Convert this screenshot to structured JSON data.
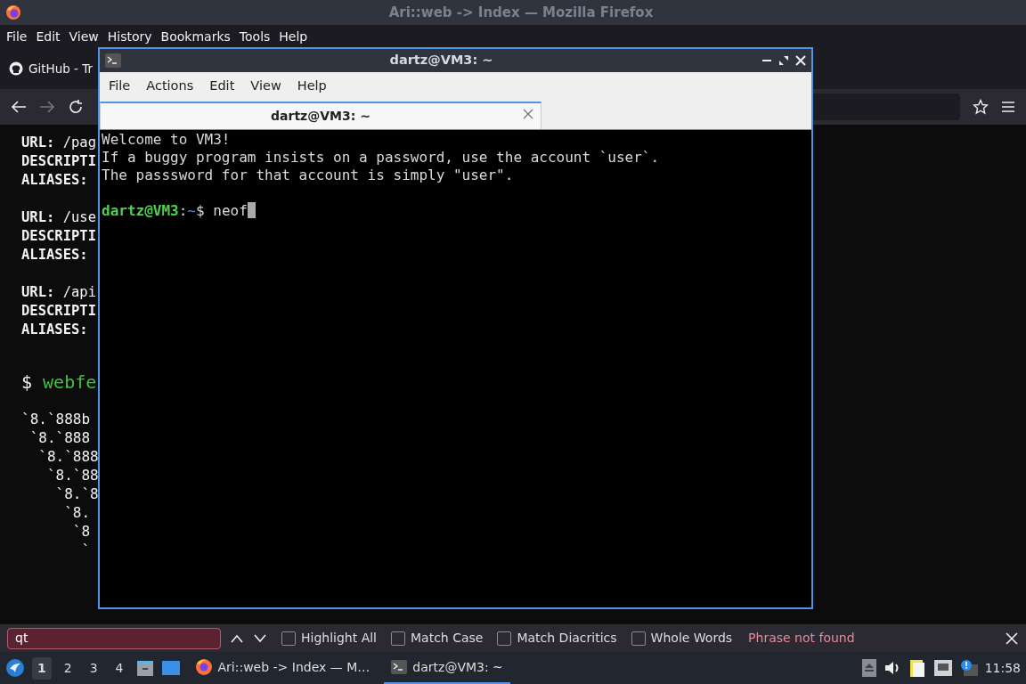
{
  "firefox": {
    "title": "Ari::web -> Index — Mozilla Firefox",
    "active": false,
    "menu": [
      "File",
      "Edit",
      "View",
      "History",
      "Bookmarks",
      "Tools",
      "Help"
    ],
    "tab": {
      "label": "GitHub - Tr"
    },
    "nav": {
      "forward": {
        "disabled": true
      }
    },
    "page": {
      "entries": [
        {
          "url": "**URL:** /pag",
          "description": "DESCRIPTI",
          "aliases": "ALIASES:"
        },
        {
          "url": "**URL:** /use",
          "description": "DESCRIPTI",
          "aliases": "ALIASES:"
        },
        {
          "url": "**URL:** /api",
          "description": "DESCRIPTI",
          "aliases": "ALIASES:"
        }
      ],
      "command": {
        "prompt": "$",
        "text": "webfe"
      },
      "art": [
        "`8.`888b",
        " `8.`888",
        "  `8.`888",
        "   `8.`88",
        "    `8.`8",
        "     `8.",
        "      `8",
        "       `"
      ]
    },
    "find_bar": {
      "value": "qt",
      "not_found": true,
      "options": [
        {
          "label": "Highlight All",
          "checked": false
        },
        {
          "label": "Match Case",
          "checked": false
        },
        {
          "label": "Match Diacritics",
          "checked": false
        },
        {
          "label": "Whole Words",
          "checked": false
        }
      ],
      "status": "Phrase not found"
    }
  },
  "terminal": {
    "title": "dartz@VM3: ~",
    "active": true,
    "menu": [
      "File",
      "Actions",
      "Edit",
      "View",
      "Help"
    ],
    "tabs": [
      {
        "label": "dartz@VM3: ~",
        "selected": true
      }
    ],
    "lines": [
      "Welcome to VM3!",
      "If a buggy program insists on a password, use the account `user`.",
      "The passsword for that account is simply \"user\"."
    ],
    "prompt": [
      {
        "text": "dartz@VM3",
        "kind": "user"
      },
      {
        "text": ":",
        "kind": "plain"
      },
      {
        "text": "~",
        "kind": "path"
      },
      {
        "text": "$ neof",
        "kind": "plain"
      }
    ]
  },
  "taskbar": {
    "workspaces": [
      {
        "label": "1",
        "selected": true
      },
      {
        "label": "2",
        "selected": false
      },
      {
        "label": "3",
        "selected": false
      },
      {
        "label": "4",
        "selected": false
      }
    ],
    "tasks": [
      {
        "label": "Ari::web -> Index — M…",
        "kind": "browser",
        "selected": false
      },
      {
        "label": "dartz@VM3: ~",
        "kind": "terminal",
        "selected": true
      }
    ],
    "clock": "11:58"
  }
}
